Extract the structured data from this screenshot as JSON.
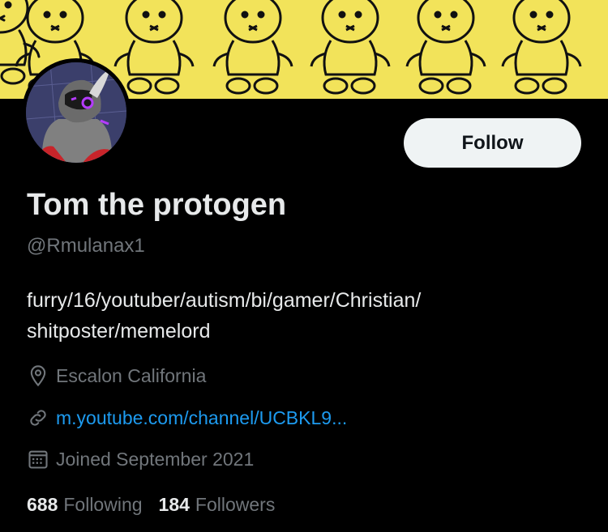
{
  "profile": {
    "display_name": "Tom the protogen",
    "handle": "@Rmulanax1",
    "bio_line1": "furry/16/youtuber/autism/bi/gamer/Christian/",
    "bio_line2": "shitposter/memelord",
    "location": "Escalon California",
    "website": "m.youtube.com/channel/UCBKL9...",
    "joined": "Joined September 2021"
  },
  "actions": {
    "follow_label": "Follow"
  },
  "stats": {
    "following_count": "688",
    "following_label": "Following",
    "followers_count": "184",
    "followers_label": "Followers"
  },
  "colors": {
    "banner": "#f2e35a",
    "link": "#1d9bf0",
    "muted": "#71767b",
    "button_bg": "#eff3f4"
  }
}
